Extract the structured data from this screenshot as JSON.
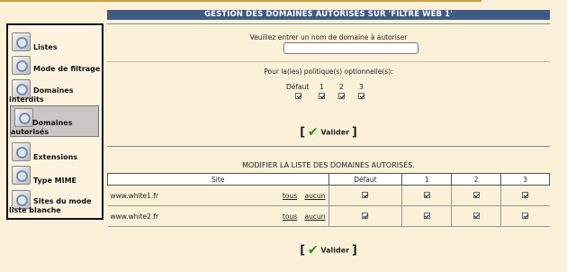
{
  "title": "GESTION DES DOMAINES AUTORISÉS SUR 'FILTRE WEB 1'",
  "sidebar": {
    "items": [
      {
        "label": "Listes",
        "icon": "page-icon",
        "active": false
      },
      {
        "label": "Mode de filtrage",
        "icon": "page-icon",
        "active": false
      },
      {
        "label": "Domaines interdits",
        "icon": "page-icon",
        "active": false
      },
      {
        "label": "Domaines autorisés",
        "icon": "page-icon",
        "active": true
      },
      {
        "label": "Extensions",
        "icon": "page-icon",
        "active": false
      },
      {
        "label": "Type MIME",
        "icon": "page-icon",
        "active": false
      },
      {
        "label": "Sites du mode liste blanche",
        "icon": "page-icon",
        "active": false
      }
    ]
  },
  "form": {
    "prompt": "Veuillez entrer un nom de domaine à autoriser",
    "domain_value": "",
    "policy_prompt": "Pour la(les) politique(s) optionnelle(s):",
    "policies": [
      {
        "label": "Défaut",
        "checked": true
      },
      {
        "label": "1",
        "checked": true
      },
      {
        "label": "2",
        "checked": true
      },
      {
        "label": "3",
        "checked": true
      }
    ],
    "submit_label": "Valider"
  },
  "list": {
    "heading": "MODIFIER LA LISTE DES DOMAINES AUTORISÉS.",
    "columns": [
      "Site",
      "Défaut",
      "1",
      "2",
      "3"
    ],
    "rows": [
      {
        "site": "www.white1.fr",
        "tous": "tous",
        "aucun": "aucun",
        "checks": [
          true,
          true,
          true,
          true
        ]
      },
      {
        "site": "www.white2.fr",
        "tous": "tous",
        "aucun": "aucun",
        "checks": [
          true,
          true,
          true,
          true
        ]
      }
    ],
    "submit_label": "Valider"
  },
  "colors": {
    "title_bar": "#3f5a84",
    "background": "#fbf0d8",
    "check_green": "#2f8a1a"
  }
}
